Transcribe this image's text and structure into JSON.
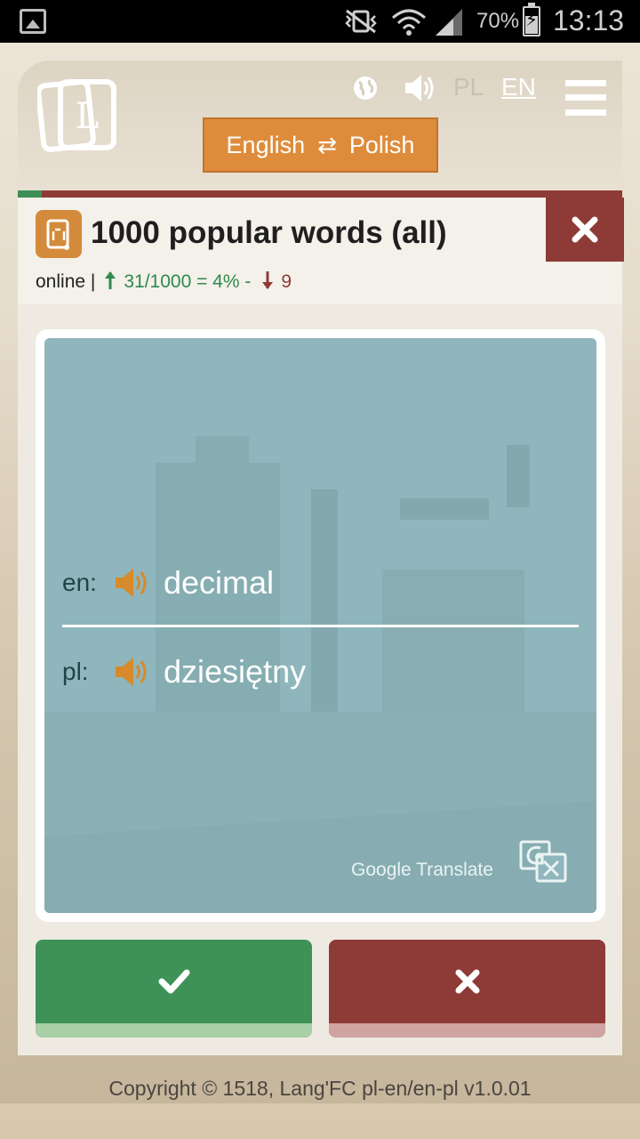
{
  "status_bar": {
    "battery_percent": "70%",
    "time": "13:13",
    "icons": [
      "gallery-icon",
      "mute-vibrate-icon",
      "wifi-icon",
      "signal-icon",
      "battery-charging-icon"
    ]
  },
  "header": {
    "logo_letter": "L",
    "language_options": {
      "pl": "PL",
      "en": "EN",
      "active": "en"
    },
    "direction": {
      "from": "English",
      "to": "Polish",
      "swap_icon": "⇄"
    },
    "icons": [
      "globe-icon",
      "speaker-icon",
      "menu-icon"
    ]
  },
  "progress": {
    "fraction": 0.04
  },
  "deck": {
    "title": "1000 popular words (all)",
    "mode": "online |",
    "known": "31/1000 = 4% -",
    "unknown": "9",
    "close_icon": "close-icon"
  },
  "card": {
    "rows": [
      {
        "label": "en:",
        "word": "decimal"
      },
      {
        "label": "pl:",
        "word": "dziesiętny"
      }
    ],
    "provider": "Google Translate"
  },
  "answers": {
    "ok_icon": "check-icon",
    "wrong_icon": "cross-icon"
  },
  "footer": {
    "copyright": "Copyright © 1518, Lang'FC pl-en/en-pl v1.0.01"
  },
  "colors": {
    "accent_orange": "#de8c3c",
    "success_green": "#3e9258",
    "danger_red": "#8e3a36",
    "card_teal": "#8fb6bc"
  }
}
